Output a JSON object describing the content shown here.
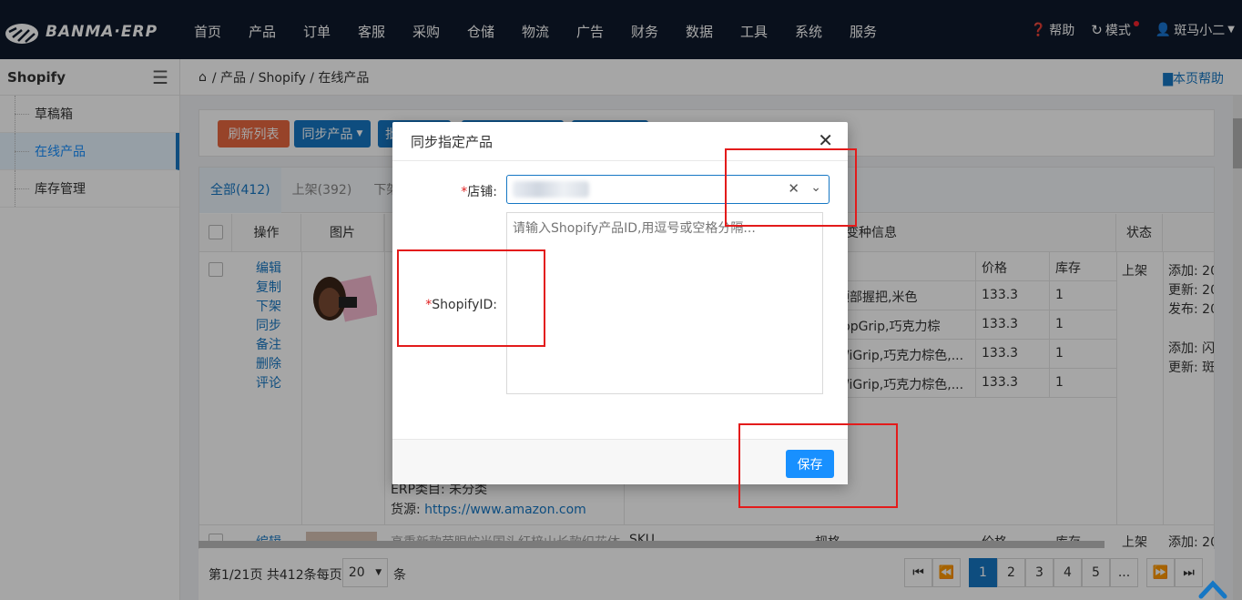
{
  "brand": {
    "name": "BANMA·ERP"
  },
  "nav": [
    "首页",
    "产品",
    "订单",
    "客服",
    "采购",
    "仓储",
    "物流",
    "广告",
    "财务",
    "数据",
    "工具",
    "系统",
    "服务"
  ],
  "top_right": {
    "help": "帮助",
    "mode": "模式",
    "user": "斑马小二"
  },
  "sidebar": {
    "title": "Shopify",
    "items": [
      {
        "label": "草稿箱"
      },
      {
        "label": "在线产品",
        "active": true
      },
      {
        "label": "库存管理"
      }
    ]
  },
  "breadcrumb": {
    "path": "/ 产品 / Shopify / 在线产品",
    "help": "本页帮助"
  },
  "toolbar": {
    "refresh": "刷新列表",
    "sync": "同步产品",
    "batch": "批"
  },
  "tabs": [
    "全部(412)",
    "上架(392)",
    "下架"
  ],
  "table": {
    "headers": {
      "ops": "操作",
      "image": "图片",
      "variant": "变种信息",
      "status": "状态"
    },
    "row1": {
      "actions": [
        "编辑",
        "复制",
        "下架",
        "同步",
        "备注",
        "删除",
        "评论"
      ],
      "variant_headers": {
        "price": "价格",
        "stock": "库存"
      },
      "variants": [
        {
          "name": "顶部握把,米色",
          "price": "133.3",
          "stock": "1"
        },
        {
          "name": "TopGrip,巧克力棕",
          "price": "133.3",
          "stock": "1"
        },
        {
          "name": "WiGrip,巧克力棕色,...",
          "price": "133.3",
          "stock": "1"
        },
        {
          "name": "WiGrip,巧克力棕色,...",
          "price": "133.3",
          "stock": "1"
        }
      ],
      "status": "上架",
      "times": [
        "添加: 20",
        "更新: 20",
        "发布: 20",
        "添加: 闪",
        "更新: 斑"
      ],
      "info_fragments": [
        "ERP类目: 未分类",
        "货源: "
      ],
      "source_link": "https://www.amazon.com"
    },
    "row2": {
      "action": "编辑",
      "title": "高重新款芭眼蛇光国头红梓山长款织花体",
      "sku": "SKU",
      "variant": "规格",
      "price": "价格",
      "stock": "库存",
      "status": "上架",
      "time": "添加: 20"
    }
  },
  "pager": {
    "summary": "第1/21页 共412条每页",
    "page_size": "20",
    "unit": "条",
    "pages": [
      "1",
      "2",
      "3",
      "4",
      "5",
      "..."
    ]
  },
  "modal": {
    "title": "同步指定产品",
    "store_label": "店铺:",
    "id_label": "ShopifyID:",
    "id_placeholder": "请输入Shopify产品ID,用逗号或空格分隔...",
    "save": "保存"
  },
  "colors": {
    "primary": "#1677c4",
    "refresh_btn": "#e8673f",
    "highlight": "#e31b1b"
  }
}
